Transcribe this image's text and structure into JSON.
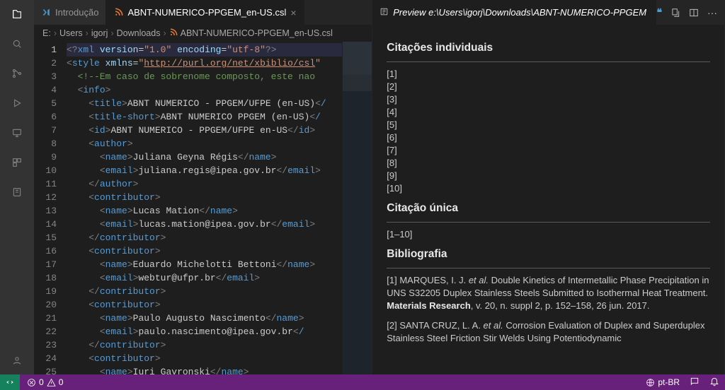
{
  "tabs": {
    "left_inactive": "Introdução",
    "left_active": "ABNT-NUMERICO-PPGEM_en-US.csl",
    "right_active": "Preview e:\\Users\\igorj\\Downloads\\ABNT-NUMERICO-PPGEM"
  },
  "breadcrumb": [
    "E:",
    "Users",
    "igorj",
    "Downloads",
    "ABNT-NUMERICO-PPGEM_en-US.csl"
  ],
  "code": {
    "lines": [
      {
        "n": 1,
        "t": "pi",
        "raw": "<?xml version=\"1.0\" encoding=\"utf-8\"?>"
      },
      {
        "n": 2,
        "t": "style",
        "raw": "<style xmlns=\"http://purl.org/net/xbiblio/csl\""
      },
      {
        "n": 3,
        "t": "cmt",
        "raw": "  <!--Em caso de sobrenome composto, este nao"
      },
      {
        "n": 4,
        "t": "tag",
        "name": "info",
        "open": true,
        "indent": 2
      },
      {
        "n": 5,
        "t": "leaf",
        "name": "title",
        "text": "ABNT NUMERICO - PPGEM/UFPE (en-US)",
        "closeTrunc": true,
        "indent": 4
      },
      {
        "n": 6,
        "t": "leaf",
        "name": "title-short",
        "text": "ABNT NUMERICO PPGEM (en-US)",
        "closeTrunc": true,
        "indent": 4
      },
      {
        "n": 7,
        "t": "leaf",
        "name": "id",
        "text": "ABNT NUMERICO - PPGEM/UFPE en-US",
        "indent": 4
      },
      {
        "n": 8,
        "t": "tag",
        "name": "author",
        "open": true,
        "indent": 4
      },
      {
        "n": 9,
        "t": "leaf",
        "name": "name",
        "text": "Juliana Geyna Régis",
        "indent": 6
      },
      {
        "n": 10,
        "t": "leaf",
        "name": "email",
        "text": "juliana.regis@ipea.gov.br",
        "indent": 6
      },
      {
        "n": 11,
        "t": "tag",
        "name": "author",
        "open": false,
        "indent": 4
      },
      {
        "n": 12,
        "t": "tag",
        "name": "contributor",
        "open": true,
        "indent": 4
      },
      {
        "n": 13,
        "t": "leaf",
        "name": "name",
        "text": "Lucas Mation",
        "indent": 6
      },
      {
        "n": 14,
        "t": "leaf",
        "name": "email",
        "text": "lucas.mation@ipea.gov.br",
        "indent": 6
      },
      {
        "n": 15,
        "t": "tag",
        "name": "contributor",
        "open": false,
        "indent": 4
      },
      {
        "n": 16,
        "t": "tag",
        "name": "contributor",
        "open": true,
        "indent": 4
      },
      {
        "n": 17,
        "t": "leaf",
        "name": "name",
        "text": "Eduardo Michelotti Bettoni",
        "indent": 6
      },
      {
        "n": 18,
        "t": "leaf",
        "name": "email",
        "text": "webtur@ufpr.br",
        "indent": 6
      },
      {
        "n": 19,
        "t": "tag",
        "name": "contributor",
        "open": false,
        "indent": 4
      },
      {
        "n": 20,
        "t": "tag",
        "name": "contributor",
        "open": true,
        "indent": 4
      },
      {
        "n": 21,
        "t": "leaf",
        "name": "name",
        "text": "Paulo Augusto Nascimento",
        "indent": 6
      },
      {
        "n": 22,
        "t": "leaf",
        "name": "email",
        "text": "paulo.nascimento@ipea.gov.br",
        "closeTrunc": true,
        "indent": 6
      },
      {
        "n": 23,
        "t": "tag",
        "name": "contributor",
        "open": false,
        "indent": 4
      },
      {
        "n": 24,
        "t": "tag",
        "name": "contributor",
        "open": true,
        "indent": 4
      },
      {
        "n": 25,
        "t": "leaf",
        "name": "name",
        "text": "Iuri Gavronski",
        "indent": 6
      }
    ]
  },
  "preview": {
    "h_individual": "Citações individuais",
    "individual_items": [
      "[1]",
      "[2]",
      "[3]",
      "[4]",
      "[5]",
      "[6]",
      "[7]",
      "[8]",
      "[9]",
      "[10]"
    ],
    "h_single": "Citação única",
    "single_item": "[1–10]",
    "h_bib": "Bibliografia",
    "bib": [
      "[1]    MARQUES, I. J. <em>et al.</em> Double Kinetics of Intermetallic Phase Precipitation in UNS S32205 Duplex Stainless Steels Submitted to Isothermal Heat Treatment. <b>Materials Research</b>, v. 20, n. suppl 2, p. 152–158, 26 jun. 2017.",
      "[2]    SANTA CRUZ, L. A. <em>et al.</em> Corrosion Evaluation of Duplex and Superduplex Stainless Steel Friction Stir Welds Using Potentiodynamic"
    ]
  },
  "status": {
    "errors": "0",
    "warnings": "0",
    "lang": "pt-BR"
  }
}
